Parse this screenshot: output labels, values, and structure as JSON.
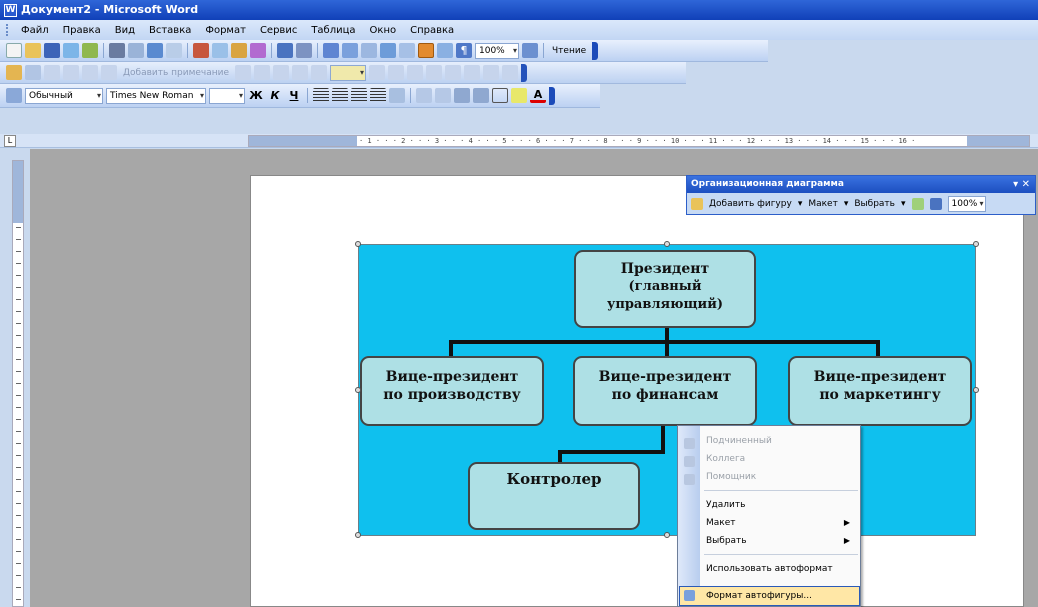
{
  "window": {
    "title": "Документ2 - Microsoft Word",
    "icon": "word-app-icon"
  },
  "menu": [
    "Файл",
    "Правка",
    "Вид",
    "Вставка",
    "Формат",
    "Сервис",
    "Таблица",
    "Окно",
    "Справка"
  ],
  "standard_toolbar": {
    "zoom": "100%",
    "reading_label": "Чтение"
  },
  "formatting_toolbar": {
    "style": "Обычный",
    "font": "Times New Roman",
    "size": ""
  },
  "reviewing_toolbar": {
    "insert_label": "Добавить примечание"
  },
  "ruler": {
    "marks": "· 1 · · · 2 · · · 3 · · · 4 · · · 5 · · · 6 · · · 7 · · · 8 · · · 9 · · · 10 · · · 11 · · · 12 · · · 13 · · · 14 · · · 15 · · · 16 ·"
  },
  "org_toolbar": {
    "title": "Организационная диаграмма",
    "insert_shape": "Добавить фигуру",
    "layout": "Макет",
    "select": "Выбрать",
    "zoom": "100%"
  },
  "org_chart": {
    "background": "#0fc0ee",
    "box_fill": "#aee0e5",
    "president": [
      "Президент",
      "(главный",
      "управляющий)"
    ],
    "vp_production": [
      "Вице-президент",
      "по производству"
    ],
    "vp_finance": [
      "Вице-президент",
      "по финансам"
    ],
    "vp_marketing": [
      "Вице-президент",
      "по маркетингу"
    ],
    "controller": "Контролер"
  },
  "context_menu": {
    "items": [
      "Подчиненный",
      "Коллега",
      "Помощник",
      "Удалить",
      "Макет",
      "Выбрать",
      "Использовать автоформат",
      "Формат автофигуры..."
    ],
    "highlighted": "Формат автофигуры..."
  }
}
